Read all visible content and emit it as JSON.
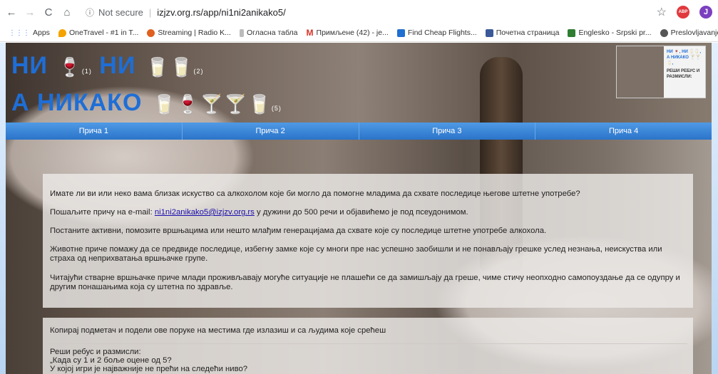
{
  "browser": {
    "security_label": "Not secure",
    "url": "izjzv.org.rs/app/ni1ni2anikako5/",
    "bookmarks": [
      {
        "label": "Apps",
        "color": "#4285f4"
      },
      {
        "label": "OneTravel - #1 in T...",
        "color": "#f4a300"
      },
      {
        "label": "Streaming | Radio K...",
        "color": "#e06020"
      },
      {
        "label": "Огласна табла",
        "color": "#888888"
      },
      {
        "label": "Примљене (42) - je...",
        "color": "#d93025"
      },
      {
        "label": "Find Cheap Flights...",
        "color": "#1f6fd1"
      },
      {
        "label": "Почетна страница",
        "color": "#3b5998"
      },
      {
        "label": "Englesko - Srpski pr...",
        "color": "#2e7d32"
      },
      {
        "label": "Preslovljavanje - Lat...",
        "color": "#555555"
      }
    ],
    "profile_initial": "J",
    "abp_label": "ABP"
  },
  "logo": {
    "line1_a": "НИ",
    "line1_b": "НИ",
    "line2": "А НИКАКО",
    "n1": "(1)",
    "n2": "(2)",
    "n5": "(5)",
    "glasses1": "🍷",
    "glasses2": "🥛🥛",
    "glasses3": "🥛🍷🍸🍸🥛"
  },
  "poster": {
    "title1": "НИ 🍷, НИ 🥛🥛,",
    "title2": "А НИКАКО 🍸🍸🥛,",
    "sub": "РЕШИ РЕБУС И РАЗМИСЛИ:"
  },
  "nav": [
    "Прича 1",
    "Прича 2",
    "Прича 3",
    "Прича 4"
  ],
  "intro": {
    "p1": "Имате ли ви или неко вама близак искуство са алкохолом које би могло да помогне младима да схвате последице његове штетне употребе?",
    "p2_before": "Пошаљите причу на e-mail: ",
    "p2_email": "ni1ni2anikako5@izjzv.org.rs",
    "p2_after": " у дужини до 500 речи и објавићемо је под псеудонимом.",
    "p3": "Постаните активни, помозите вршњацима или нешто млађим генерацијама да схвате које су последице штетне употребе алкохола.",
    "p4": "Животне приче помажу да се предвиде последице, избегну замке које су многи пре нас успешно заобишли и не понављају грешке услед незнања, неискуства или страха од неприхватања вршњачке групе.",
    "p5": "Читајући стварне вршњачке приче млади проживљавају могуће ситуације не плашећи се да замишљају да греше, чиме стичу неопходно самопоуздање да се одупру и другим понашањима која су штетна по здравље."
  },
  "rebus": {
    "heading": "Копирај подметач и подели ове поруке на местима где излазиш и са људима које срећеш",
    "l1": "Реши ребус и размисли:",
    "l2": "„Када су 1 и 2 боље оцене од 5?",
    "l3": "У којој игри је најважније не прећи на следећи ниво?"
  }
}
